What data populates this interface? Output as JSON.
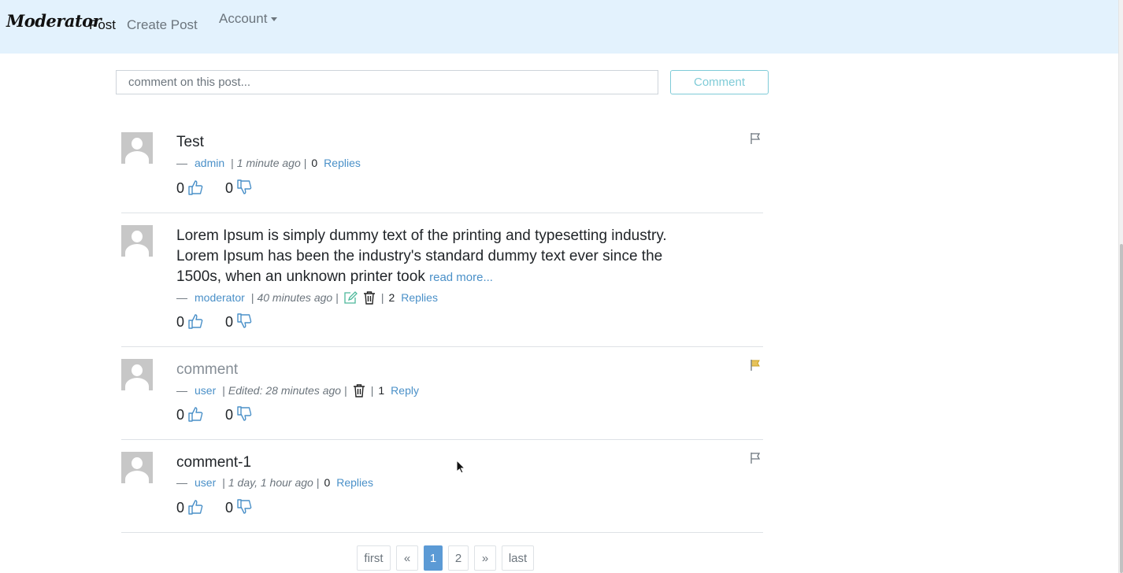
{
  "navbar": {
    "brand": "Moderator",
    "links": [
      "Post",
      "Create Post"
    ],
    "account": "Account"
  },
  "comment_form": {
    "placeholder": "comment on this post...",
    "button": "Comment"
  },
  "comments": [
    {
      "text": "Test",
      "dash": "—",
      "user": "admin",
      "time": "1 minute ago",
      "reply_count": "0",
      "reply_label": "Replies",
      "likes": "0",
      "dislikes": "0",
      "flag_color": "#6c757d"
    },
    {
      "text": "Lorem Ipsum is simply dummy text of the printing and typesetting industry. Lorem Ipsum has been the industry's standard dummy text ever since the 1500s, when an unknown printer took",
      "read_more": "read more...",
      "dash": "—",
      "user": "moderator",
      "time": "40 minutes ago",
      "reply_count": "2",
      "reply_label": "Replies",
      "likes": "0",
      "dislikes": "0"
    },
    {
      "text": "comment",
      "dash": "—",
      "user": "user",
      "time": "Edited: 28 minutes ago",
      "reply_count": "1",
      "reply_label": "Reply",
      "likes": "0",
      "dislikes": "0",
      "flag_color": "#c9a227"
    },
    {
      "text": "comment-1",
      "dash": "—",
      "user": "user",
      "time": "1 day, 1 hour ago",
      "reply_count": "0",
      "reply_label": "Replies",
      "likes": "0",
      "dislikes": "0",
      "flag_color": "#6c757d"
    }
  ],
  "pagination": {
    "first": "first",
    "prev": "«",
    "pages": [
      "1",
      "2"
    ],
    "active": "1",
    "next": "»",
    "last": "last"
  },
  "colors": {
    "navbar_bg": "#e3f2fd",
    "link": "#4a90c8",
    "accent": "#17a2b8",
    "active_page": "#5b9ad5"
  }
}
